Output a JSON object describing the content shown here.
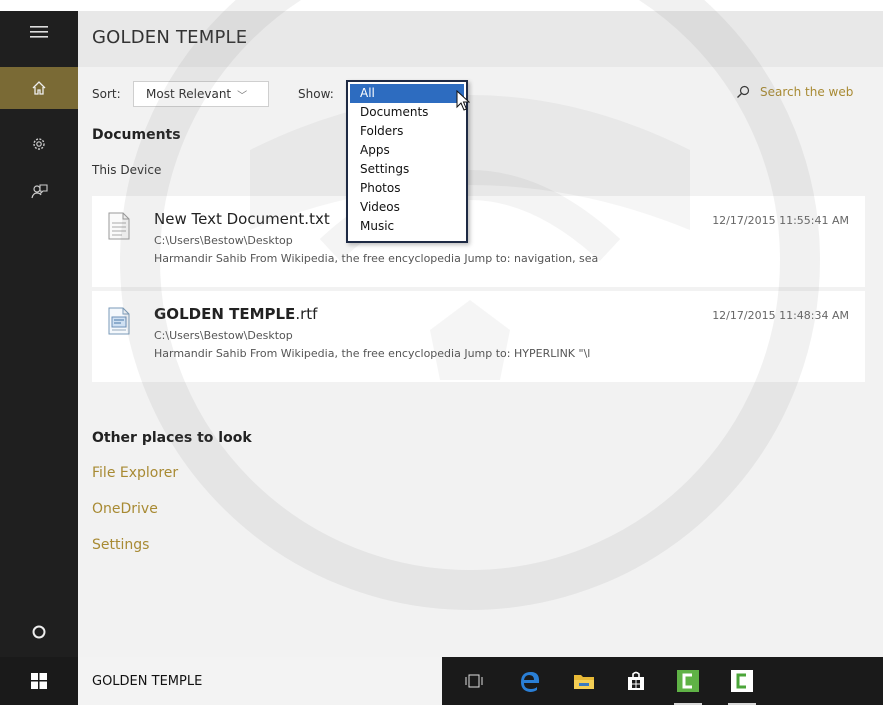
{
  "search": {
    "query": "GOLDEN TEMPLE",
    "sort_label": "Sort:",
    "sort_value": "Most Relevant",
    "show_label": "Show:",
    "search_web": "Search the web"
  },
  "rail": {
    "items": [
      {
        "name": "home",
        "icon": "home-icon",
        "active": true
      },
      {
        "name": "settings",
        "icon": "gear-icon",
        "active": false
      },
      {
        "name": "feedback",
        "icon": "feedback-icon",
        "active": false
      }
    ],
    "cortana_icon": "cortana-circle-icon"
  },
  "show_dropdown": {
    "selected": "All",
    "options": [
      "All",
      "Documents",
      "Folders",
      "Apps",
      "Settings",
      "Photos",
      "Videos",
      "Music"
    ]
  },
  "results": {
    "section_title": "Documents",
    "subtitle": "This Device",
    "items": [
      {
        "name": "New Text Document.txt",
        "name_bold": "",
        "name_rest": "New Text Document.txt",
        "path": "C:\\Users\\Bestow\\Desktop",
        "snippet": "Harmandir Sahib From Wikipedia, the free encyclopedia Jump to: navigation, sea",
        "date": "12/17/2015 11:55:41 AM",
        "icon": "text-file-icon"
      },
      {
        "name": "GOLDEN TEMPLE.rtf",
        "name_bold": "GOLDEN TEMPLE",
        "name_rest": ".rtf",
        "path": "C:\\Users\\Bestow\\Desktop",
        "snippet": "Harmandir Sahib From Wikipedia, the free encyclopedia Jump to: HYPERLINK \"\\l",
        "date": "12/17/2015 11:48:34 AM",
        "icon": "rtf-file-icon"
      }
    ]
  },
  "other_places": {
    "title": "Other places to look",
    "links": [
      "File Explorer",
      "OneDrive",
      "Settings"
    ]
  },
  "taskbar": {
    "search_text": "GOLDEN TEMPLE",
    "icons": [
      "task-view-icon",
      "edge-icon",
      "file-explorer-icon",
      "store-icon",
      "camtasia-icon",
      "camtasia-recorder-icon"
    ]
  },
  "colors": {
    "accent": "#a88a33",
    "rail_bg": "#1f1f1f",
    "rail_active": "#7a6a35",
    "dropdown_selected": "#2d6cc0"
  }
}
